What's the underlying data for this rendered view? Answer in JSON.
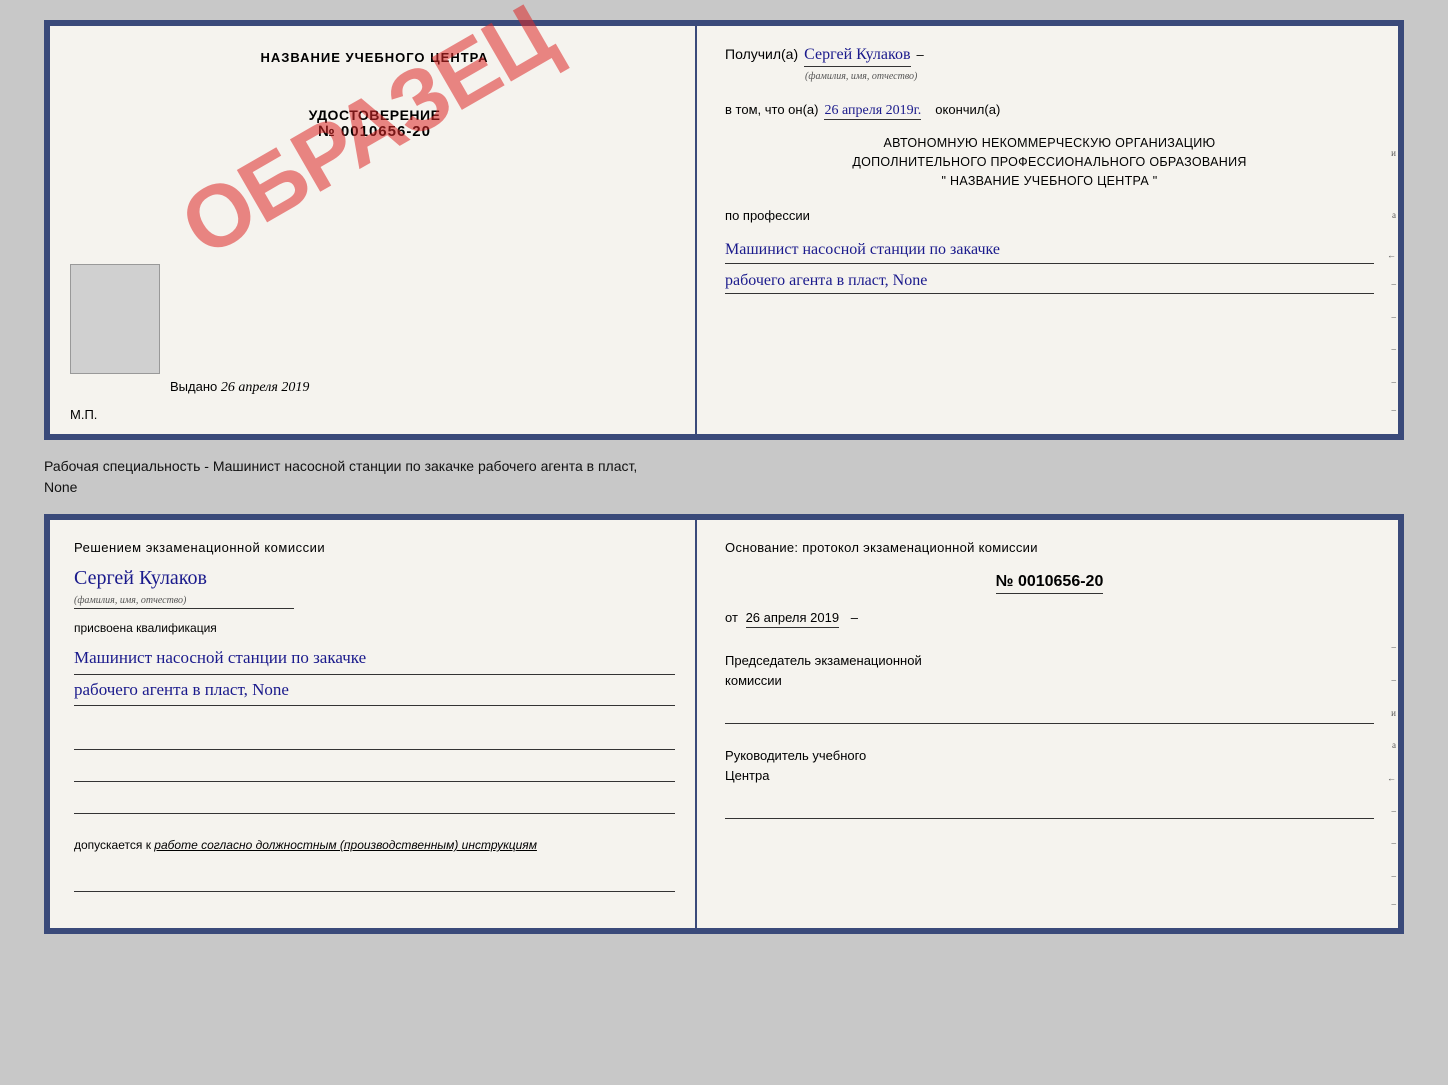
{
  "top_left": {
    "center_title": "НАЗВАНИЕ УЧЕБНОГО ЦЕНТРА",
    "obrazec": "ОБРАЗЕЦ",
    "udostoverenie_label": "УДОСТОВЕРЕНИЕ",
    "udostoverenie_number": "№ 0010656-20",
    "vydano_label": "Выдано",
    "vydano_date": "26 апреля 2019",
    "mp_label": "М.П."
  },
  "top_right": {
    "poluchil_label": "Получил(а)",
    "poluchil_name": "Сергей Кулаков",
    "poluchil_subtext": "(фамилия, имя, отчество)",
    "dash1": "–",
    "vtom_label": "в том, что он(а)",
    "vtom_date": "26 апреля 2019г.",
    "okonchil_label": "окончил(а)",
    "org_line1": "АВТОНОМНУЮ НЕКОММЕРЧЕСКУЮ ОРГАНИЗАЦИЮ",
    "org_line2": "ДОПОЛНИТЕЛЬНОГО ПРОФЕССИОНАЛЬНОГО ОБРАЗОВАНИЯ",
    "org_name_quotes": "\" НАЗВАНИЕ УЧЕБНОГО ЦЕНТРА \"",
    "po_professii": "по профессии",
    "profession_line1": "Машинист насосной станции по закачке",
    "profession_line2": "рабочего агента в пласт, None"
  },
  "separator": {
    "text_line1": "Рабочая специальность - Машинист насосной станции по закачке рабочего агента в пласт,",
    "text_line2": "None"
  },
  "bottom_left": {
    "resheniem": "Решением экзаменационной комиссии",
    "name": "Сергей Кулаков",
    "name_subtext": "(фамилия, имя, отчество)",
    "prisvoena": "присвоена квалификация",
    "qualification_line1": "Машинист насосной станции по закачке",
    "qualification_line2": "рабочего агента в пласт, None",
    "dopuskaetsya_prefix": "допускается к",
    "dopuskaetsya_text": "работе согласно должностным (производственным) инструкциям"
  },
  "bottom_right": {
    "osnovanie": "Основание: протокол экзаменационной комиссии",
    "protocol_number": "№ 0010656-20",
    "ot_label": "от",
    "ot_date": "26 апреля 2019",
    "predsedatel_line1": "Председатель экзаменационной",
    "predsedatel_line2": "комиссии",
    "rukovoditel_line1": "Руководитель учебного",
    "rukovoditel_line2": "Центра"
  },
  "right_margin_labels": {
    "letters": [
      "и",
      "а",
      "←",
      "–",
      "–",
      "–",
      "–",
      "–"
    ]
  }
}
